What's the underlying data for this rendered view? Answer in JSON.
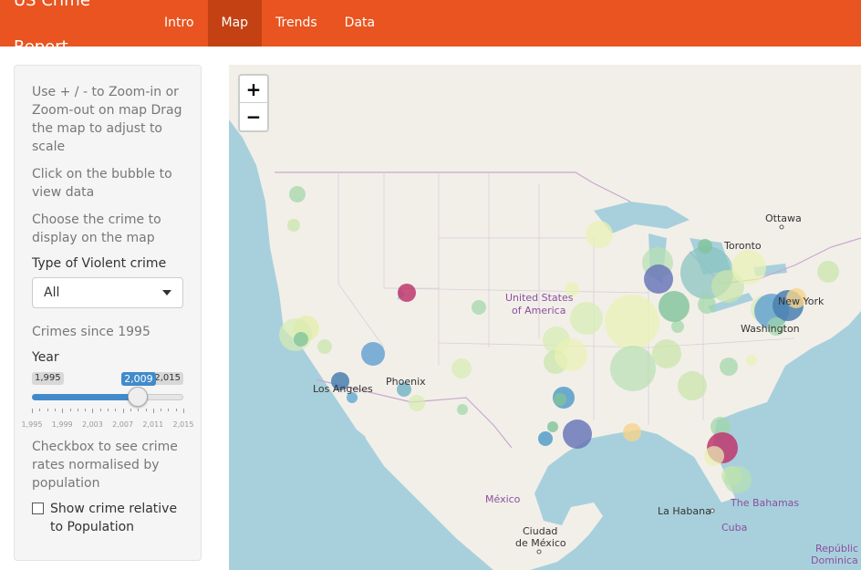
{
  "app": {
    "title": "US Crime Report"
  },
  "nav": {
    "tabs": [
      {
        "label": "Intro"
      },
      {
        "label": "Map"
      },
      {
        "label": "Trends"
      },
      {
        "label": "Data"
      }
    ],
    "active": "Map"
  },
  "sidebar": {
    "help1": "Use + / - to Zoom-in or Zoom-out on map Drag the map to adjust to scale",
    "help2": "Click on the bubble to view data",
    "help3": "Choose the crime to display on the map",
    "crime_type_label": "Type of Violent crime",
    "crime_type_value": "All",
    "since_text": "Crimes since 1995",
    "year_label": "Year",
    "year_min": "1,995",
    "year_max": "2,015",
    "year_value": "2,009",
    "year_fraction": 0.7,
    "tick_labels": [
      "1,995",
      "1,999",
      "2,003",
      "2,007",
      "2,011",
      "2,015"
    ],
    "checkbox_help": "Checkbox to see crime rates normalised by population",
    "checkbox_label": "Show crime relative to Population",
    "checkbox_checked": false
  },
  "map": {
    "zoom_in": "+",
    "zoom_out": "−",
    "labels": {
      "ottawa": "Ottawa",
      "toronto": "Toronto",
      "new_york": "New York",
      "washington": "Washington",
      "usa_line1": "United States",
      "usa_line2": "of America",
      "phoenix": "Phoenix",
      "los_angeles": "Los Angeles",
      "mexico": "México",
      "ciudad1": "Ciudad",
      "ciudad2": "de México",
      "havana": "La Habana",
      "bahamas": "The Bahamas",
      "cuba": "Cuba",
      "republica1": "Repúblic",
      "republica2": "Dominica"
    },
    "colors": {
      "land": "#f2efe9",
      "water": "#a8d0dc",
      "border": "#c9a7cf"
    }
  }
}
